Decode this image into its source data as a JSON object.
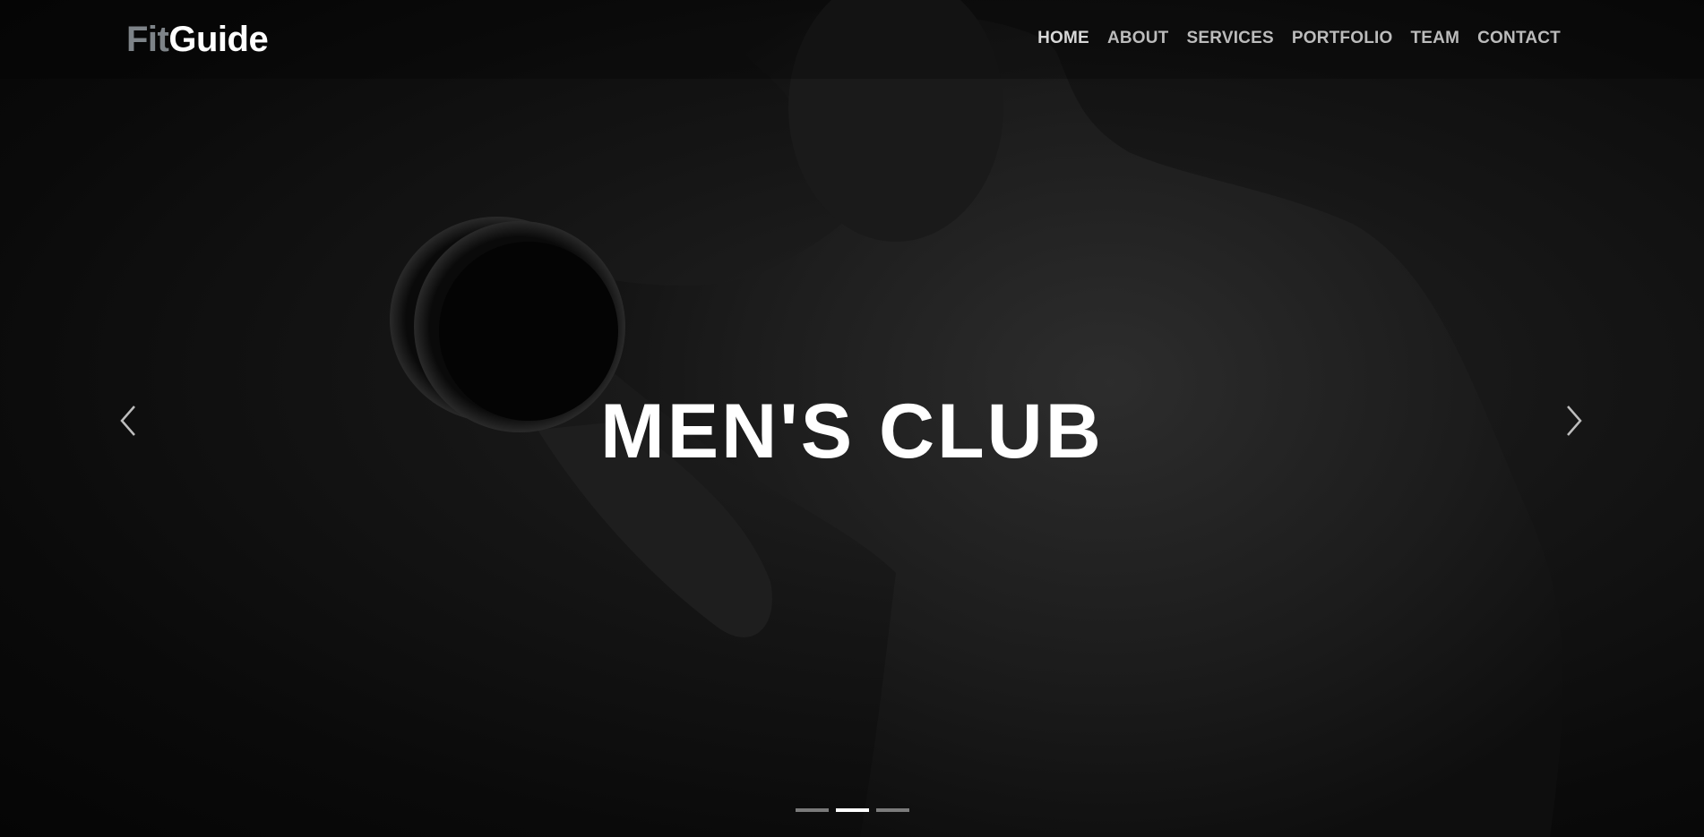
{
  "brand": {
    "part1": "Fit",
    "part2": "Guide",
    "part1_color": "#7d8388",
    "part2_color": "#ffffff"
  },
  "nav": {
    "items": [
      {
        "label": "HOME"
      },
      {
        "label": "ABOUT"
      },
      {
        "label": "SERVICES"
      },
      {
        "label": "PORTFOLIO"
      },
      {
        "label": "TEAM"
      },
      {
        "label": "CONTACT"
      }
    ]
  },
  "hero": {
    "headline": "MEN'S CLUB",
    "background_image": "dark monochrome photo of muscular man lifting a dumbbell",
    "prev_icon": "chevron-left-icon",
    "next_icon": "chevron-right-icon"
  },
  "carousel": {
    "slide_count": 3,
    "active_index": 1
  }
}
